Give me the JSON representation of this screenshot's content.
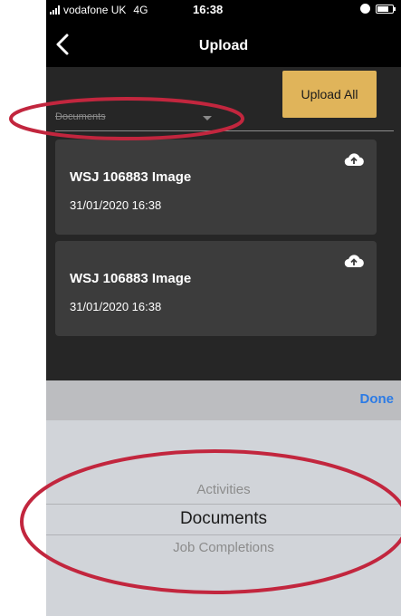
{
  "status_bar": {
    "carrier": "vodafone UK",
    "network": "4G",
    "time": "16:38",
    "battery_level": 0.75
  },
  "nav": {
    "title": "Upload"
  },
  "toolbar": {
    "upload_all_label": "Upload All"
  },
  "picker_field": {
    "value": "Documents"
  },
  "uploads": [
    {
      "title": "WSJ 106883 Image",
      "date": "31/01/2020 16:38",
      "icon": "cloud-upload-icon"
    },
    {
      "title": "WSJ 106883 Image",
      "date": "31/01/2020 16:38",
      "icon": "cloud-upload-icon"
    }
  ],
  "picker": {
    "done_label": "Done",
    "options": [
      "Activities",
      "Documents",
      "Job Completions"
    ],
    "selected": "Documents"
  },
  "colors": {
    "accent": "#e0b45a",
    "done": "#2c7be5",
    "annotation": "#c2263e",
    "card": "#3c3c3c"
  }
}
